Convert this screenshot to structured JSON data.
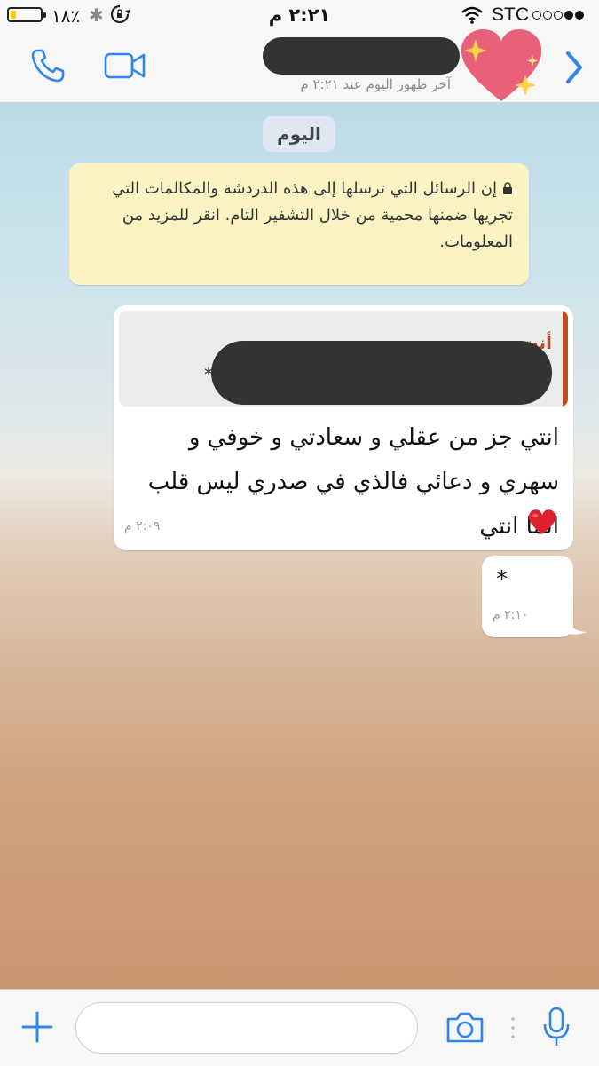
{
  "status_bar": {
    "battery_percent": "٪١٨",
    "battery_level": 0.18,
    "time": "٢:٢١ م",
    "carrier": "STC",
    "signal_strength": 2,
    "signal_total": 5,
    "icons": [
      "bluetooth-icon",
      "rotation-lock-icon",
      "wifi-icon"
    ]
  },
  "header": {
    "last_seen": "آخر ظهور اليوم عند ٢:٢١ م",
    "icons": [
      "phone-icon",
      "video-icon",
      "chevron-right-icon"
    ],
    "accent_color": "#2f86eb"
  },
  "chat": {
    "date_chip": "اليوم",
    "encryption_notice": "إن الرسائل التي ترسلها إلى هذه الدردشة والمكالمات التي تجريها ضمنها محمية من خلال التشفير التام. انقر للمزيد من المعلومات.",
    "messages": [
      {
        "direction": "incoming",
        "quote_author": "أنت",
        "quote_text": "*",
        "text": "انتي جز من عقلي و سعادتي و خوفي و سهري و دعائي فالذي في صدري ليس قلب انما انتي",
        "emoji": "heart-emoji",
        "time": "٢:٠٩ م"
      },
      {
        "direction": "outgoing",
        "text": "*",
        "time": "٢:١٠ م"
      }
    ]
  },
  "input_bar": {
    "placeholder": "",
    "icons": [
      "plus-icon",
      "camera-icon",
      "microphone-icon"
    ]
  }
}
